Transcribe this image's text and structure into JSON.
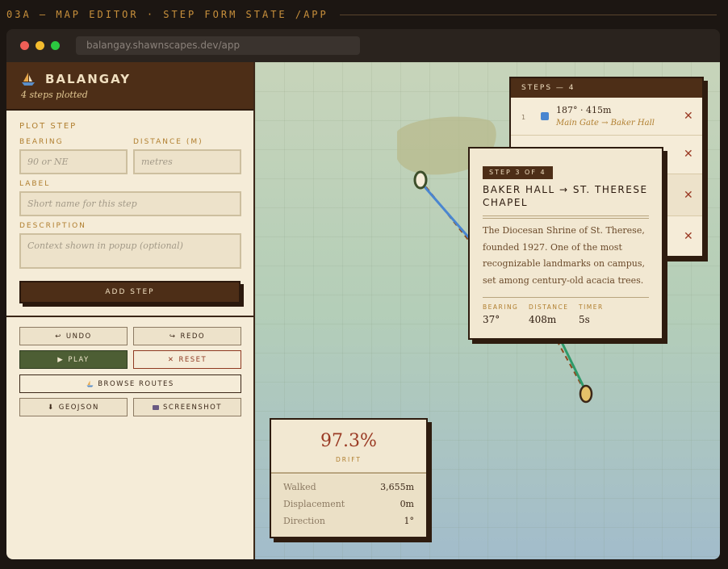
{
  "caption": "03A — MAP EDITOR · STEP FORM STATE  /APP",
  "browser": {
    "url": "balangay.shawnscapes.dev/app",
    "dots": [
      "#ee5f57",
      "#f4bc2e",
      "#2bc840"
    ]
  },
  "brand": {
    "title": "BALANGAY",
    "subtitle": "4 steps plotted",
    "icon": "sailboat-icon"
  },
  "form": {
    "section_title": "PLOT STEP",
    "bearing_label": "BEARING",
    "bearing_placeholder": "90 or NE",
    "distance_label": "DISTANCE (M)",
    "distance_placeholder": "metres",
    "label_label": "LABEL",
    "label_placeholder": "Short name for this step",
    "description_label": "DESCRIPTION",
    "description_placeholder": "Context shown in popup (optional)",
    "add_button": "ADD STEP"
  },
  "toolbar": {
    "undo": "UNDO",
    "redo": "REDO",
    "play": "PLAY",
    "reset": "RESET",
    "browse": "BROWSE ROUTES",
    "geojson": "GEOJSON",
    "screenshot": "SCREENSHOT"
  },
  "steps_panel": {
    "title": "STEPS — 4",
    "rows": [
      {
        "num": "1",
        "color": "#4a86d0",
        "meta": "187° · 415m",
        "route": "Main Gate → Baker Hall"
      }
    ]
  },
  "popup": {
    "badge": "STEP 3 OF 4",
    "title": "BAKER HALL → ST. THERESE CHAPEL",
    "description": "The Diocesan Shrine of St. Therese, founded 1927. One of the most recognizable landmarks on campus, set among century-old acacia trees.",
    "bearing_label": "BEARING",
    "bearing": "37°",
    "distance_label": "DISTANCE",
    "distance": "408m",
    "timer_label": "TIMER",
    "timer": "5s"
  },
  "drift": {
    "value": "97.3%",
    "label": "DRIFT",
    "walked_label": "Walked",
    "walked": "3,655m",
    "displacement_label": "Displacement",
    "displacement": "0m",
    "direction_label": "Direction",
    "direction": "1°"
  },
  "colors": {
    "route_blue": "#4a86d0",
    "route_green": "#2e9a6a",
    "dashed": "#8b4a1e",
    "accent_brown": "#4d2e17",
    "accent_gold": "#b07e2e"
  }
}
